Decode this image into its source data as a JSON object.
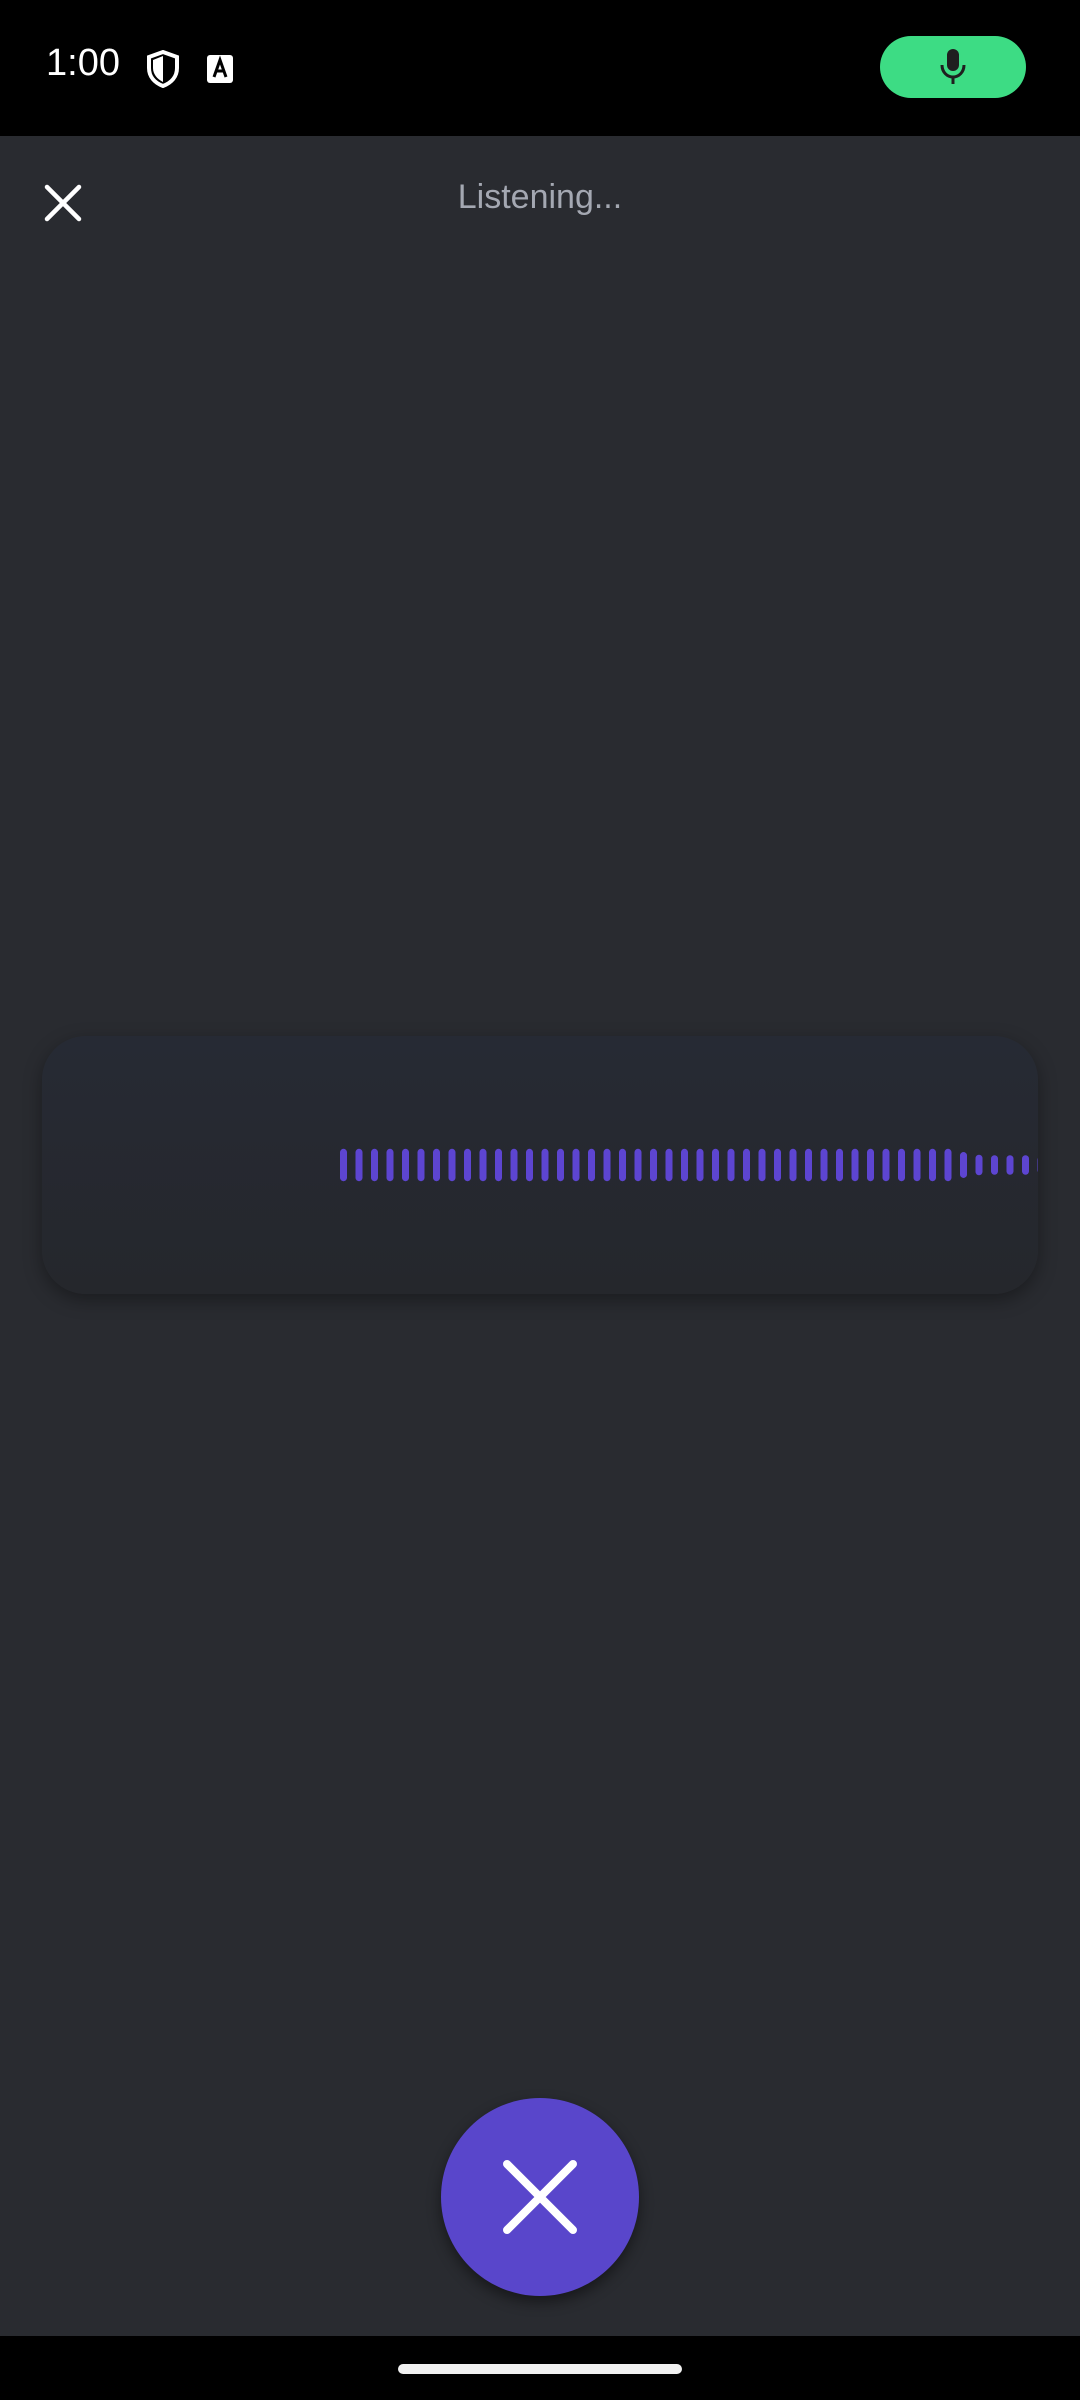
{
  "status_bar": {
    "time": "1:00",
    "icons": [
      "shield-icon",
      "font-a-icon"
    ],
    "mic_indicator_icon": "microphone-icon",
    "mic_indicator_color": "#3ddc84"
  },
  "header": {
    "close_icon": "close-icon",
    "title": "Listening..."
  },
  "waveform": {
    "color": "#5d45d1",
    "levels": [
      0.6,
      0.6,
      0.6,
      0.6,
      0.6,
      0.6,
      0.6,
      0.6,
      0.6,
      0.6,
      0.6,
      0.6,
      0.6,
      0.6,
      0.6,
      0.6,
      0.6,
      0.6,
      0.6,
      0.6,
      0.6,
      0.6,
      0.6,
      0.6,
      0.6,
      0.6,
      0.6,
      0.6,
      0.6,
      0.6,
      0.6,
      0.6,
      0.6,
      0.6,
      0.6,
      0.6,
      0.6,
      0.6,
      0.6,
      0.6,
      0.48,
      0.38,
      0.36,
      0.36,
      0.36,
      0.32,
      0.26,
      0.2,
      0.15,
      0.15,
      0.15,
      0.26,
      0.26
    ]
  },
  "cancel_button": {
    "icon": "close-icon",
    "color": "#5946cb"
  },
  "colors": {
    "background": "#292b30",
    "accent": "#5946cb",
    "status_bar": "#000000"
  }
}
